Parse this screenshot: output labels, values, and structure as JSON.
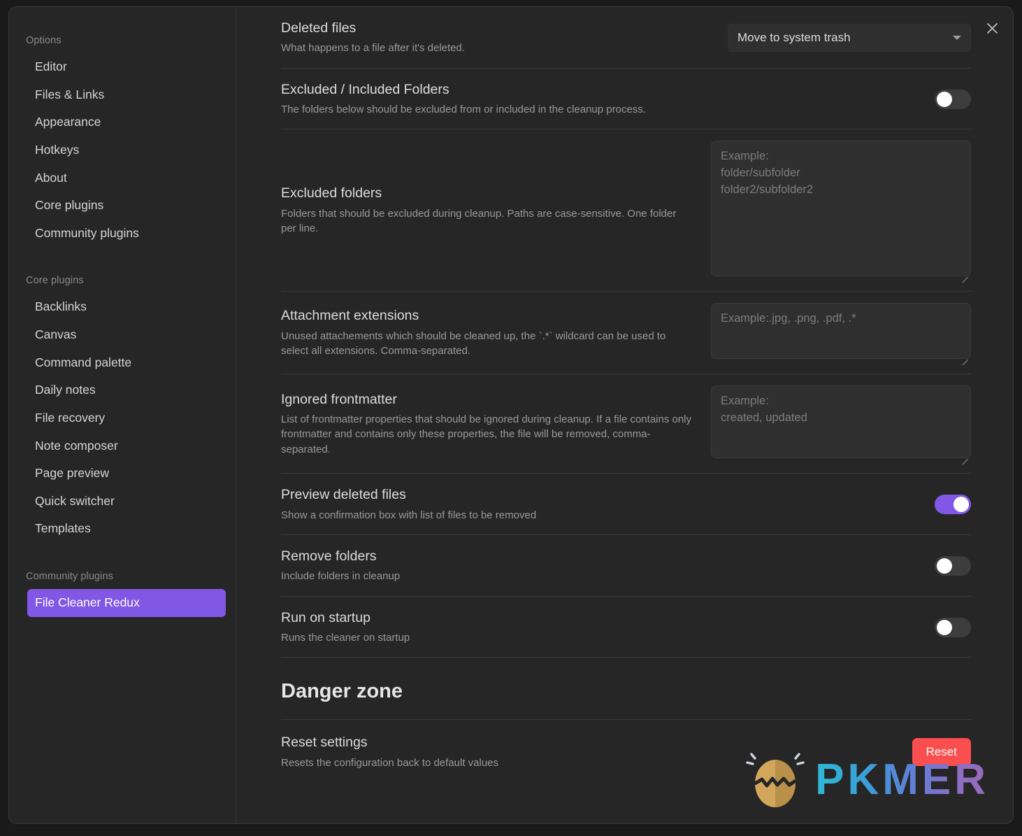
{
  "window": {
    "close_icon": "close-icon"
  },
  "sidebar": {
    "groups": [
      {
        "title": "Options",
        "items": [
          {
            "label": "Editor"
          },
          {
            "label": "Files & Links"
          },
          {
            "label": "Appearance"
          },
          {
            "label": "Hotkeys"
          },
          {
            "label": "About"
          },
          {
            "label": "Core plugins"
          },
          {
            "label": "Community plugins"
          }
        ]
      },
      {
        "title": "Core plugins",
        "items": [
          {
            "label": "Backlinks"
          },
          {
            "label": "Canvas"
          },
          {
            "label": "Command palette"
          },
          {
            "label": "Daily notes"
          },
          {
            "label": "File recovery"
          },
          {
            "label": "Note composer"
          },
          {
            "label": "Page preview"
          },
          {
            "label": "Quick switcher"
          },
          {
            "label": "Templates"
          }
        ]
      },
      {
        "title": "Community plugins",
        "items": [
          {
            "label": "File Cleaner Redux",
            "active": true
          }
        ]
      }
    ],
    "active_color": "#8257e5"
  },
  "settings": {
    "deleted_files": {
      "name": "Deleted files",
      "desc": "What happens to a file after it's deleted.",
      "dropdown_value": "Move to system trash",
      "caret_icon": "chevron-down-icon"
    },
    "excluded_included_folders": {
      "name": "Excluded / Included Folders",
      "desc": "The folders below should be excluded from or included in the cleanup process.",
      "toggle_state": "off"
    },
    "excluded_folders": {
      "name": "Excluded folders",
      "desc": "Folders that should be excluded during cleanup. Paths are case-sensitive. One folder per line.",
      "placeholder": "Example:\nfolder/subfolder\nfolder2/subfolder2",
      "value": ""
    },
    "attachment_extensions": {
      "name": "Attachment extensions",
      "desc": "Unused attachements which should be cleaned up, the `.*` wildcard can be used to select all extensions. Comma-separated.",
      "placeholder": "Example:.jpg, .png, .pdf, .*",
      "value": ""
    },
    "ignored_frontmatter": {
      "name": "Ignored frontmatter",
      "desc": "List of frontmatter properties that should be ignored during cleanup. If a file contains only frontmatter and contains only these properties, the file will be removed, comma-separated.",
      "placeholder": "Example:\ncreated, updated",
      "value": ""
    },
    "preview_deleted_files": {
      "name": "Preview deleted files",
      "desc": "Show a confirmation box with list of files to be removed",
      "toggle_state": "on"
    },
    "remove_folders": {
      "name": "Remove folders",
      "desc": "Include folders in cleanup",
      "toggle_state": "off"
    },
    "run_on_startup": {
      "name": "Run on startup",
      "desc": "Runs the cleaner on startup",
      "toggle_state": "off"
    }
  },
  "danger_zone": {
    "heading": "Danger zone",
    "reset_settings": {
      "name": "Reset settings",
      "desc": "Resets the configuration back to default values",
      "button_label": "Reset",
      "button_color": "#fb4e4e"
    }
  },
  "watermark": {
    "text": "PKMER",
    "logo_icon": "pkmer-egg-logo-icon"
  }
}
